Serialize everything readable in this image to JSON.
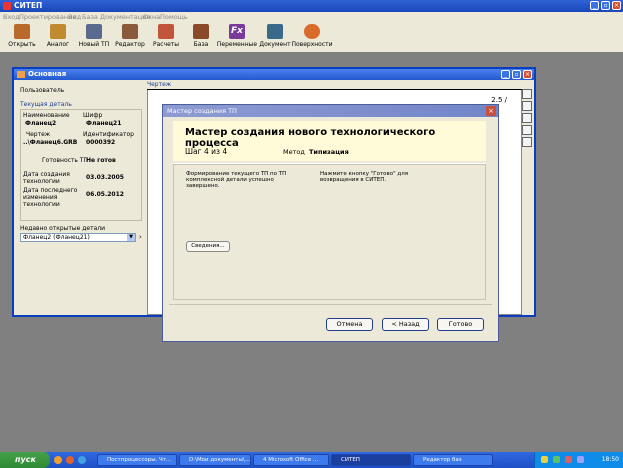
{
  "app": {
    "title": "СИТЕП"
  },
  "menu": [
    "Вход",
    "Проектирование",
    "Вид",
    "База",
    "Документация",
    "Окна",
    "Помощь"
  ],
  "toolbar": [
    {
      "label": "Открыть",
      "icon": "open-icon",
      "color": "#b76a2a"
    },
    {
      "label": "Аналог",
      "icon": "analog-icon",
      "color": "#c08a2e"
    },
    {
      "label": "Новый ТП",
      "icon": "new-tp-icon",
      "color": "#5a6a8e"
    },
    {
      "label": "Редактор",
      "icon": "editor-icon",
      "color": "#8a5a3a"
    },
    {
      "label": "Расчеты",
      "icon": "calc-icon",
      "color": "#c0553a"
    },
    {
      "label": "База",
      "icon": "database-icon",
      "color": "#8a4a2a"
    },
    {
      "label": "Переменные",
      "icon": "variables-icon",
      "color": "#7a3a9a"
    },
    {
      "label": "Документ",
      "icon": "document-icon",
      "color": "#3a6a8a"
    },
    {
      "label": "Поверхности",
      "icon": "surfaces-icon",
      "color": "#d86a2a"
    }
  ],
  "main_window": {
    "title": "Основная",
    "user_label": "Пользователь",
    "current_part_header": "Текущая деталь",
    "name_label": "Наименование",
    "name_value": "Фланец2",
    "code_label": "Шифр",
    "code_value": "Фланец21",
    "drawing_label": "Чертеж",
    "drawing_value": "..\\Фланец6.GRB",
    "id_label": "Идентификатор",
    "id_value": "0000392",
    "ready_label": "Готовность ТП",
    "ready_value": "Не готов",
    "created_label": "Дата создания технологии",
    "created_value": "03.03.2005",
    "modified_label": "Дата последнего изменения технологии",
    "modified_value": "06.05.2012",
    "recent_label": "Недавно открытые детали",
    "recent_value": "Фланец2 (Фланец21)",
    "drawing_tab": "Чертеж",
    "drawing_corner": "2.5 ∕"
  },
  "dialog": {
    "title": "Мастер создания ТП",
    "heading": "Мастер создания нового технологического процесса",
    "step_text": "Шаг 4 из 4",
    "method_label": "Метод",
    "method_value": "Типизация",
    "left_text": "Формирование текущего ТП по ТП комплексной детали успешно завершено.",
    "right_text": "Нажмите кнопку \"Готово\" для возвращения в СИТЕП.",
    "info_button": "Сведения...",
    "cancel_button": "Отмена",
    "back_button": "< Назад",
    "done_button": "Готово"
  },
  "taskbar": {
    "start": "пуск",
    "tasks": [
      "Постпроцессоры. Чт...",
      "D:\\Мои документы\\...",
      "4 Microsoft Office ...",
      "СИТЕП",
      "Редактор баз"
    ],
    "clock": "18:50"
  }
}
